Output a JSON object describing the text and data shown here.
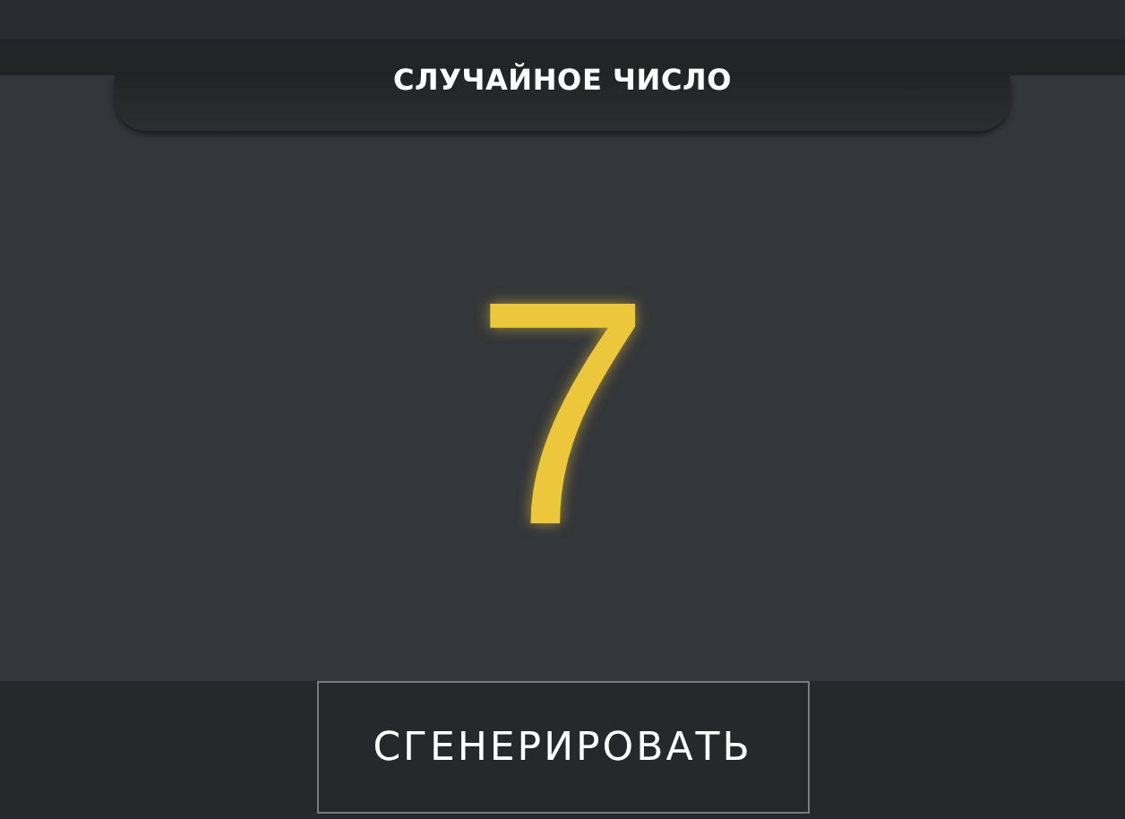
{
  "header": {
    "title": "СЛУЧАЙНОЕ ЧИСЛО"
  },
  "result": {
    "value": "7"
  },
  "generate_button": {
    "label": "СГЕНЕРИРОВАТЬ"
  }
}
